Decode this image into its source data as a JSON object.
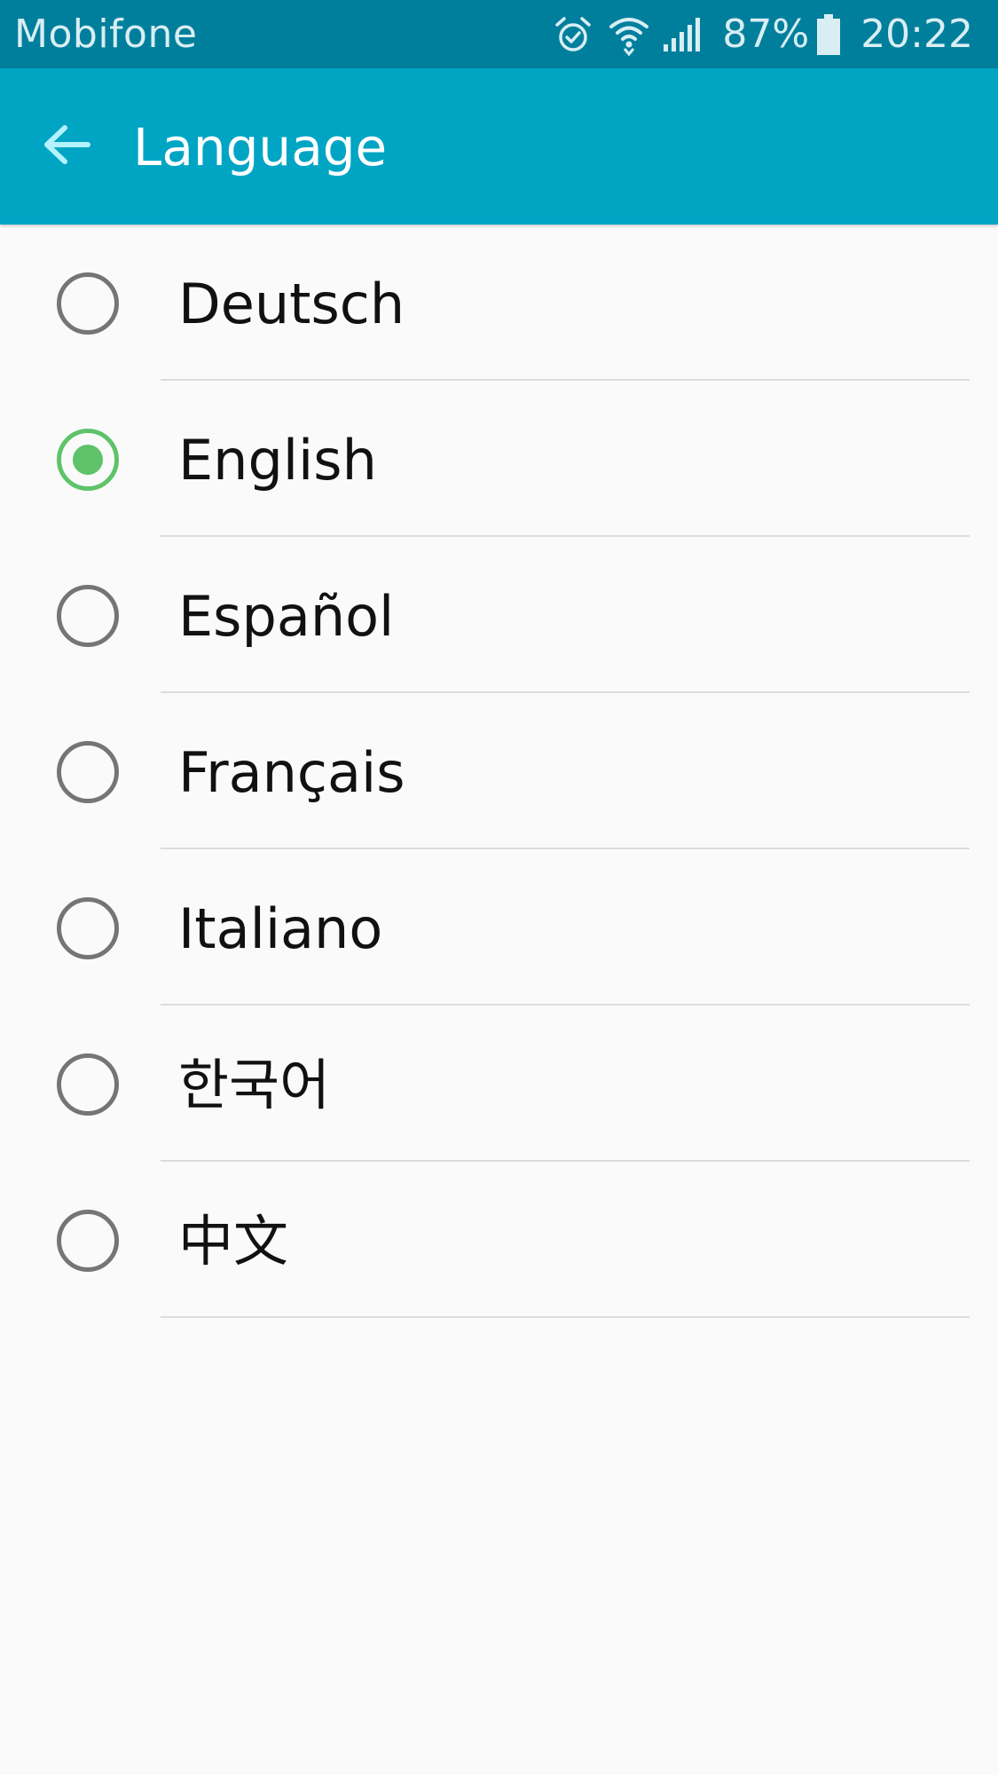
{
  "status_bar": {
    "carrier": "Mobifone",
    "battery_percent": "87%",
    "time": "20:22",
    "icons": [
      "alarm-icon",
      "wifi-icon",
      "signal-icon",
      "battery-icon"
    ]
  },
  "app_bar": {
    "title": "Language",
    "back_icon": "arrow-left-icon"
  },
  "languages": [
    {
      "label": "Deutsch",
      "selected": false
    },
    {
      "label": "English",
      "selected": true
    },
    {
      "label": "Español",
      "selected": false
    },
    {
      "label": "Français",
      "selected": false
    },
    {
      "label": "Italiano",
      "selected": false
    },
    {
      "label": "한국어",
      "selected": false
    },
    {
      "label": "中文",
      "selected": false
    }
  ],
  "colors": {
    "status_bar": "#007f9d",
    "app_bar": "#00a5c4",
    "back_arrow": "#b3f2ff",
    "radio_selected": "#5ec36a",
    "radio_unselected": "#757575",
    "background": "#fafafa"
  }
}
